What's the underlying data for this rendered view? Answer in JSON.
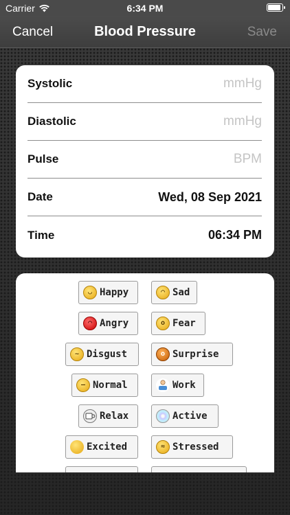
{
  "status_bar": {
    "carrier": "Carrier",
    "time": "6:34 PM"
  },
  "nav": {
    "cancel": "Cancel",
    "title": "Blood Pressure",
    "save": "Save"
  },
  "form": {
    "systolic": {
      "label": "Systolic",
      "placeholder": "mmHg"
    },
    "diastolic": {
      "label": "Diastolic",
      "placeholder": "mmHg"
    },
    "pulse": {
      "label": "Pulse",
      "placeholder": "BPM"
    },
    "date": {
      "label": "Date",
      "value": "Wed, 08 Sep 2021"
    },
    "time": {
      "label": "Time",
      "value": "06:34 PM"
    }
  },
  "moods": {
    "happy": "Happy",
    "sad": "Sad",
    "angry": "Angry",
    "fear": "Fear",
    "disgust": "Disgust",
    "surprise": "Surprise",
    "normal": "Normal",
    "work": "Work",
    "relax": "Relax",
    "active": "Active",
    "excited": "Excited",
    "stressed": "Stressed"
  },
  "icons": {
    "wifi": "wifi-icon",
    "battery": "battery-icon",
    "happy": "happy-face-icon",
    "sad": "sad-face-icon",
    "angry": "angry-face-icon",
    "fear": "fearful-face-icon",
    "disgust": "disgusted-face-icon",
    "surprise": "surprised-face-icon",
    "normal": "neutral-face-icon",
    "work": "office-worker-icon",
    "relax": "coffee-cup-icon",
    "active": "cd-disc-icon",
    "excited": "excited-figure-icon",
    "stressed": "stressed-face-icon"
  }
}
